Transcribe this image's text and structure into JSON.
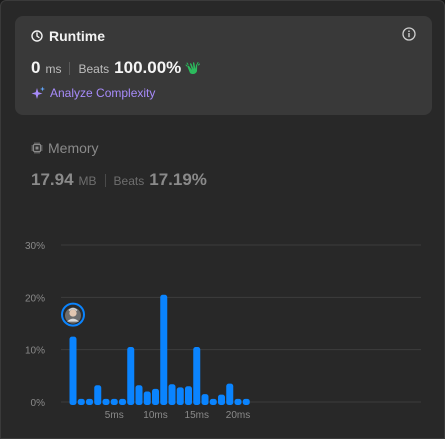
{
  "runtime": {
    "title": "Runtime",
    "value": "0",
    "unit": "ms",
    "beats_label": "Beats",
    "beats_value": "100.00%",
    "analyze_label": "Analyze Complexity"
  },
  "memory": {
    "title": "Memory",
    "value": "17.94",
    "unit": "MB",
    "beats_label": "Beats",
    "beats_value": "17.19%"
  },
  "colors": {
    "bar": "#0a84ff",
    "accent_purple": "#a78bfa",
    "clap": "#2cbb5d"
  },
  "icons": [
    "clock-icon",
    "info-icon",
    "clap-icon",
    "sparkle-icon",
    "chip-icon",
    "avatar"
  ],
  "chart_data": {
    "type": "bar",
    "y_ticks": [
      "30%",
      "20%",
      "10%",
      "0%"
    ],
    "x_ticks": [
      {
        "x": 5,
        "label": "5ms"
      },
      {
        "x": 10,
        "label": "10ms"
      },
      {
        "x": 15,
        "label": "15ms"
      },
      {
        "x": 20,
        "label": "20ms"
      }
    ],
    "x": [
      0,
      1,
      2,
      3,
      4,
      5,
      6,
      7,
      8,
      9,
      10,
      11,
      12,
      13,
      14,
      15,
      16,
      17,
      18,
      19,
      20,
      21
    ],
    "values": [
      12.5,
      0.6,
      0.6,
      3.2,
      0.6,
      0.6,
      0.6,
      10.5,
      3.2,
      2.0,
      2.5,
      20.5,
      3.4,
      2.8,
      3.0,
      10.5,
      1.5,
      0.6,
      1.4,
      3.5,
      0.6,
      0.6
    ],
    "ylim": [
      0,
      30
    ],
    "grid": true,
    "marker_index": 0
  }
}
